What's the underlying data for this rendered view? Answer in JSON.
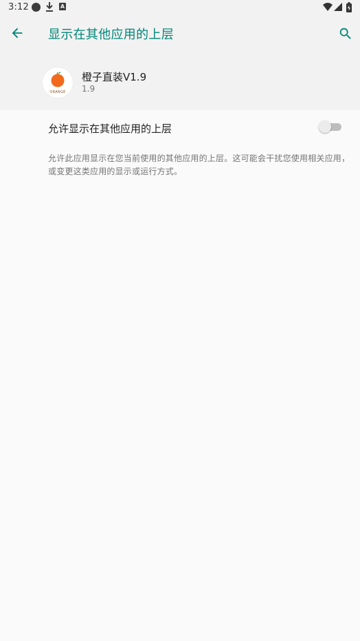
{
  "status_bar": {
    "time": "3:12",
    "icons": [
      "notification-dot-icon",
      "download-icon",
      "a-box-icon",
      "wifi-icon",
      "cell-signal-icon",
      "battery-icon"
    ]
  },
  "app_bar": {
    "title": "显示在其他应用的上层",
    "back_icon": "arrow-back-icon",
    "search_icon": "search-icon",
    "accent_color": "#008577"
  },
  "app_header": {
    "name": "橙子直装V1.9",
    "version": "1.9",
    "icon_text": "ORANGE"
  },
  "preference": {
    "title": "允许显示在其他应用的上层",
    "enabled": false,
    "summary": "允许此应用显示在您当前使用的其他应用的上层。这可能会干扰您使用相关应用，或变更这类应用的显示或运行方式。"
  }
}
